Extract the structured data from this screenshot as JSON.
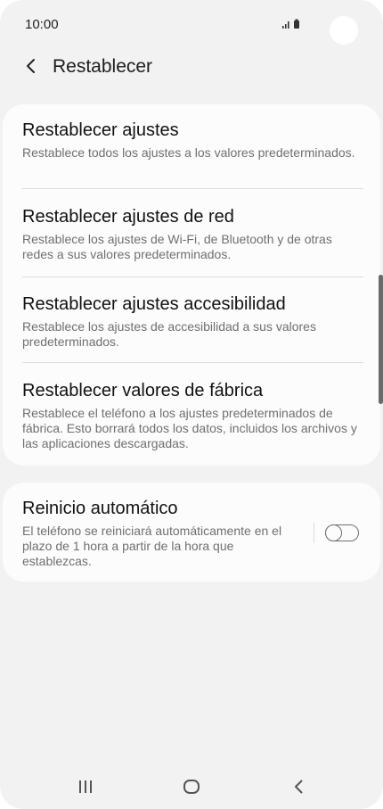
{
  "status_bar": {
    "time": "10:00"
  },
  "header": {
    "title": "Restablecer"
  },
  "settings": [
    {
      "title": "Restablecer ajustes",
      "description": "Restablece todos los ajustes a los valores predeterminados."
    },
    {
      "title": "Restablecer ajustes de red",
      "description": "Restablece los ajustes de Wi-Fi, de Bluetooth y de otras redes a sus valores predeterminados."
    },
    {
      "title": "Restablecer ajustes accesibilidad",
      "description": "Restablece los ajustes de accesibilidad a sus valores predeterminados."
    },
    {
      "title": "Restablecer valores de fábrica",
      "description": "Restablece el teléfono a los ajustes predeterminados de fábrica. Esto borrará todos los datos, incluidos los archivos y las aplicaciones descargadas."
    }
  ],
  "auto_restart": {
    "title": "Reinicio automático",
    "description": "El teléfono se reiniciará automáticamente en el plazo de 1 hora a partir de la hora que establezcas.",
    "enabled": false
  },
  "icons": {
    "status": [
      "signal-icon",
      "battery-icon"
    ],
    "header": "back-arrow-icon",
    "nav": [
      "recent-apps-icon",
      "home-icon",
      "back-nav-icon"
    ]
  },
  "colors": {
    "background": "#f2f2f2",
    "card": "#fcfcfc",
    "text_primary": "#111111",
    "text_secondary": "#6f6f6f"
  }
}
